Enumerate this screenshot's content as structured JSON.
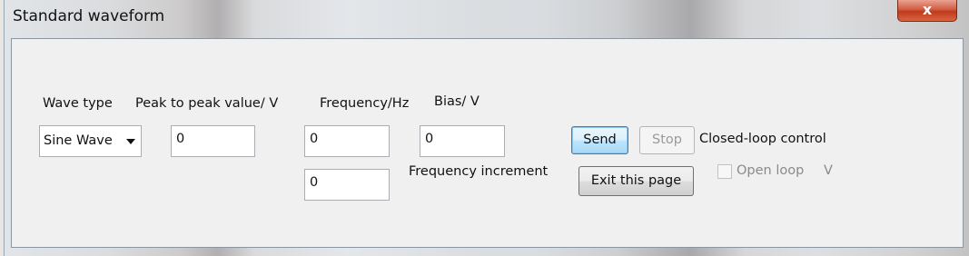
{
  "window": {
    "title": "Standard waveform",
    "close_glyph": "x"
  },
  "labels": {
    "wave_type": "Wave type",
    "peak_to_peak": "Peak to peak value/ V",
    "frequency": "Frequency/Hz",
    "bias": "Bias/  V",
    "frequency_increment": "Frequency increment",
    "closed_loop_control": "Closed-loop control",
    "open_loop": "Open loop",
    "open_loop_unit": "V"
  },
  "wave_type_select": {
    "selected": "Sine Wave"
  },
  "fields": {
    "peak_to_peak": "0",
    "frequency": "0",
    "bias": "0",
    "frequency_increment": "0"
  },
  "buttons": {
    "send": "Send",
    "stop": "Stop",
    "exit": "Exit this page"
  },
  "checkbox": {
    "open_loop_checked": false,
    "enabled": false
  },
  "icons": {
    "close": "close-icon",
    "dropdown": "chevron-down-icon"
  }
}
